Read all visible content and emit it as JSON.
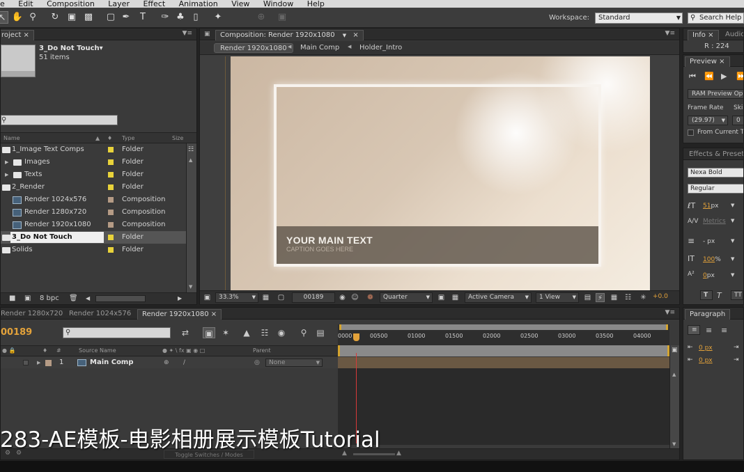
{
  "menu": [
    "e",
    "Edit",
    "Composition",
    "Layer",
    "Effect",
    "Animation",
    "View",
    "Window",
    "Help"
  ],
  "toolbar": {
    "workspace_label": "Workspace:",
    "workspace_value": "Standard",
    "search_help": "Search Help"
  },
  "project": {
    "tab": "roject",
    "selected_name": "3_Do Not Touch▾",
    "item_count": "51 items",
    "columns": {
      "name": "Name",
      "type": "Type",
      "size": "Size"
    },
    "items": [
      {
        "name": "1_Image Text Comps",
        "type": "Folder",
        "color": "#e8d23a"
      },
      {
        "name": "Images",
        "type": "Folder",
        "color": "#e8d23a"
      },
      {
        "name": "Texts",
        "type": "Folder",
        "color": "#e8d23a"
      },
      {
        "name": "2_Render",
        "type": "Folder",
        "color": "#e8d23a"
      },
      {
        "name": "Render 1024x576",
        "type": "Composition",
        "color": "#b59b85"
      },
      {
        "name": "Render 1280x720",
        "type": "Composition",
        "color": "#b59b85"
      },
      {
        "name": "Render 1920x1080",
        "type": "Composition",
        "color": "#b59b85"
      },
      {
        "name": "3_Do Not Touch",
        "type": "Folder",
        "color": "#e8d23a"
      },
      {
        "name": "Solids",
        "type": "Folder",
        "color": "#e8d23a"
      }
    ],
    "bpc": "8 bpc"
  },
  "comp": {
    "tab": "Composition: Render 1920x1080",
    "breadcrumbs": [
      "Render 1920x1080",
      "Main Comp",
      "Holder_Intro"
    ],
    "main_text": "YOUR MAIN TEXT",
    "caption_text": "CAPTION GOES HERE",
    "zoom": "33.3%",
    "timecode": "00189",
    "resolution": "Quarter",
    "camera": "Active Camera",
    "views": "1 View",
    "exposure": "+0.0"
  },
  "info": {
    "tab": "Info",
    "tab2": "Audio",
    "r_value": "R : 224"
  },
  "preview": {
    "tab": "Preview",
    "ram_preview": "RAM Preview Op",
    "frame_rate_label": "Frame Rate",
    "skip_label": "Skip",
    "frame_rate_value": "(29.97)",
    "skip_value": "0",
    "from_current": "From Current T"
  },
  "character": {
    "tab": "Effects & Presets",
    "font": "Nexa Bold",
    "style": "Regular",
    "size": "51",
    "size_unit": "px",
    "kerning": "Metrics",
    "leading_unit": "- px",
    "vscale": "100",
    "vscale_unit": "%",
    "baseline": "0",
    "baseline_unit": "px"
  },
  "paragraph": {
    "tab": "Paragraph",
    "indent1": "0 px",
    "indent2": "0 px"
  },
  "timeline": {
    "tabs": [
      "Render 1280x720",
      "Render 1024x576",
      "Render 1920x1080"
    ],
    "current_time": "00189",
    "columns": {
      "source": "Source Name",
      "parent": "Parent"
    },
    "ruler_ticks": [
      "0000",
      "00500",
      "01000",
      "01500",
      "02000",
      "02500",
      "03000",
      "03500",
      "04000"
    ],
    "layer": {
      "num": "1",
      "name": "Main Comp",
      "parent": "None"
    },
    "toggle": "Toggle Switches / Modes"
  },
  "subtitle": "283-AE模板-电影相册展示模板Tutorial"
}
